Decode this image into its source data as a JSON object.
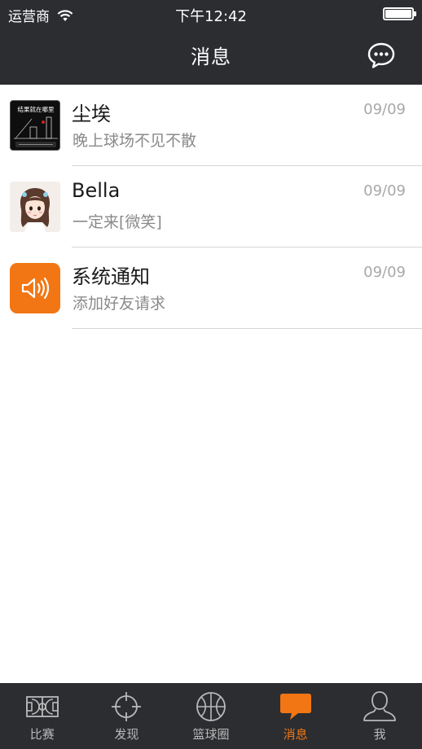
{
  "status_bar": {
    "carrier": "运营商",
    "time": "下午12:42"
  },
  "nav": {
    "title": "消息",
    "right_icon": "chat-bubble-icon"
  },
  "conversations": [
    {
      "name": "尘埃",
      "preview": "晚上球场不见不散",
      "date": "09/09",
      "avatar": "court-photo-avatar",
      "avatar_text": "结果就在哪里"
    },
    {
      "name": "Bella",
      "preview": "一定来[微笑]",
      "date": "09/09",
      "avatar": "girl-avatar"
    },
    {
      "name": "系统通知",
      "preview": "添加好友请求",
      "date": "09/09",
      "avatar": "speaker-icon"
    }
  ],
  "tabs": [
    {
      "label": "比赛",
      "icon": "court-icon",
      "active": false
    },
    {
      "label": "发现",
      "icon": "crosshair-icon",
      "active": false
    },
    {
      "label": "篮球圈",
      "icon": "basketball-icon",
      "active": false
    },
    {
      "label": "消息",
      "icon": "message-icon",
      "active": true
    },
    {
      "label": "我",
      "icon": "person-icon",
      "active": false
    }
  ],
  "colors": {
    "bar_background": "#2b2d31",
    "accent": "#f27613",
    "inactive_tab": "#b9b9b9"
  }
}
